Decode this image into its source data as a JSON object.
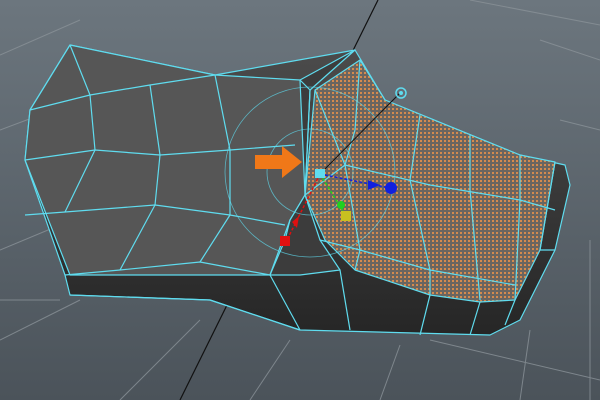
{
  "viewport": {
    "mode": "face-selection",
    "tool": "move-manipulator"
  },
  "colors": {
    "background_top": "#6c767e",
    "background_bottom": "#4b535a",
    "grid": "#8a9298",
    "mesh_face": "#474747",
    "mesh_face_light": "#5a5a5a",
    "wireframe": "#5fdcef",
    "selected_face": "#c7844f",
    "axis_x": "#e01010",
    "axis_y": "#20d020",
    "axis_z": "#1020e0",
    "callout_arrow": "#f07818"
  },
  "icons": [
    "orange-arrow-icon",
    "move-manipulator-icon",
    "pivot-target-icon"
  ]
}
